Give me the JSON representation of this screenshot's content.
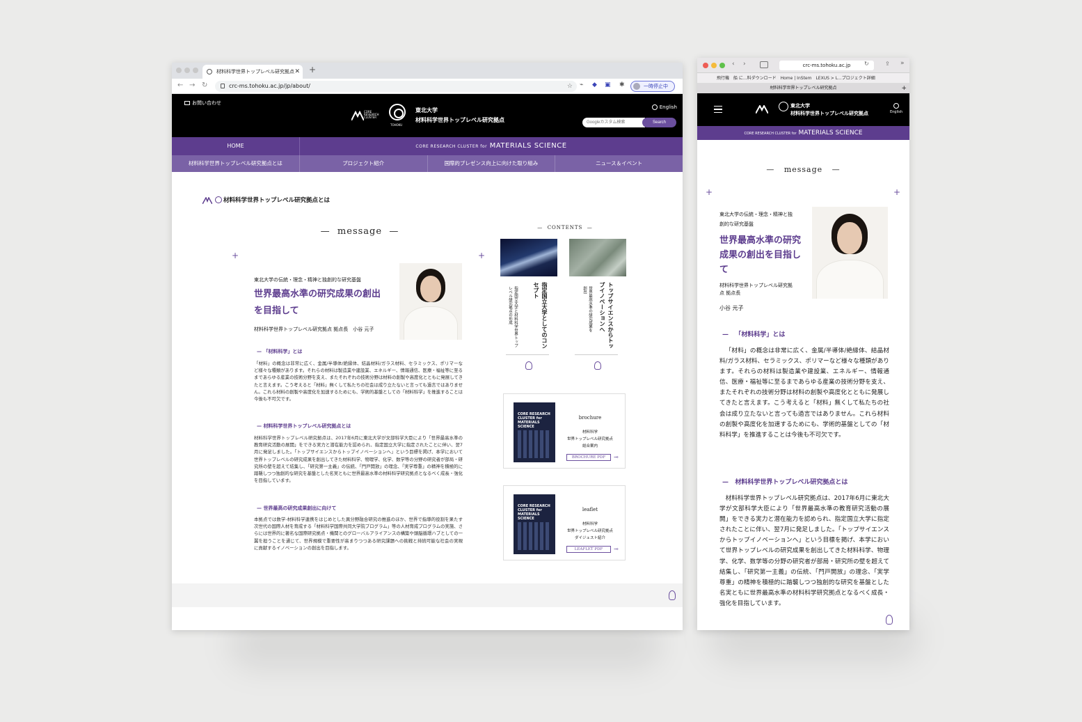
{
  "desktop": {
    "tab_title": "材料科学世界トップレベル研究拠点",
    "url": "crc-ms.tohoku.ac.jp/jp/about/",
    "pause_label": "一時停止中",
    "header": {
      "contact": "お問い合わせ",
      "crc_logo_text": "CORE RESEARCH CLUSTER",
      "tohoku_logo_text": "TOHOKU",
      "univ": "東北大学",
      "center": "材料科学世界トップレベル研究拠点",
      "english": "English",
      "search_placeholder": "Googleカスタム検索",
      "search_button": "Search"
    },
    "nav": {
      "home": "HOME",
      "banner_small": "CORE RESEARCH CLUSTER for",
      "banner_big": "MATERIALS SCIENCE",
      "items": [
        "材料科学世界トップレベル研究拠点とは",
        "プロジェクト紹介",
        "国際的プレゼンス向上に向けた取り組み",
        "ニュース＆イベント"
      ]
    },
    "breadcrumb": "材料科学世界トップレベル研究拠点とは",
    "message_title": "message",
    "lead_sub": "東北大学の伝統・理念・精神と独創的な研究基盤",
    "lead_heading": "世界最高水準の研究成果の創出を目指して",
    "lead_name": "材料科学世界トップレベル研究拠点 拠点長　小谷 元子",
    "sections": [
      {
        "heading": "「材料科学」とは",
        "text": "「材料」の概念は非常に広く、金属/半導体/絶縁体、結晶材料/ガラス材料、セラミックス、ポリマーなど様々な種類があります。それらの材料は製造業や建設業、エネルギー、情報通信、医療・福祉等に至るまであらゆる産業の技術分野を支え、またそれぞれの技術分野は材料の創製や高度化とともに発展してきたと言えます。こう考えると「材料」無くして私たちの社会は成り立たないと言っても過言ではありません。これら材料の創製や高度化を加速するためにも、学術的基盤としての「材料科学」を推進することは今後も不可欠です。"
      },
      {
        "heading": "材料科学世界トップレベル研究拠点とは",
        "text": "材料科学世界トップレベル研究拠点は、2017年6月に東北大学が文部科学大臣により「世界最高水準の教育研究活動の展開」をできる実力と潜在能力を認められ、指定国立大学に指定されたことに伴い、翌7月に発足しました。「トップサイエンスからトップイノベーションへ」という目標を掲げ、本学において世界トップレベルの研究成果を創出してきた材料科学、物理学、化学、数学等の分野の研究者が部局・研究所の壁を超えて結集し、「研究第一主義」の伝統、「門戸開放」の理念、「実学尊重」の精神を積極的に踏襲しつつ独創的な研究を基盤とした名実ともに世界最高水準の材料科学研究拠点となるべく成長・強化を目指しています。"
      },
      {
        "heading": "世界最高の研究成果創出に向けて",
        "text": "本拠点では数学-材料科学連携をはじめとした異分野融合研究の推進のほか、世界で指導的役割を果たす次世代の国際人材を育成する「材料科学国際共同大学院プログラム」等の人材育成プログラムの実施、さらには世界的に著名な国際研究拠点・機関とのグローバルアライアンスの構築や頭脳循環ハブとしての一翼を担うことを通じて、世界規模で重要性が高まりつつある研究課題への挑戦と持続可能な社会の実現に貢献するイノベーションの創出を目指します。"
      }
    ],
    "contents_title": "CONTENTS",
    "cards": [
      {
        "title": "指定国立大学としてのコンセプト",
        "desc": "指定国立大学と材料科学世界トップレベル研究拠点の形成"
      },
      {
        "title": "トップサイエンスからトップイノベーションへ",
        "desc": "世界最高水準の研究成果を創出"
      }
    ],
    "pdfs": [
      {
        "label": "brochure",
        "desc1": "材料科学",
        "desc2": "世界トップレベル研究拠点",
        "desc3": "総合案内",
        "button": "BROCHURE PDF",
        "cover": "CORE RESEARCH CLUSTER for MATERIALS SCIENCE"
      },
      {
        "label": "leaflet",
        "desc1": "材料科学",
        "desc2": "世界トップレベル研究拠点",
        "desc3": "ダイジェスト紹介",
        "button": "LEAFLET PDF",
        "cover": "CORE RESEARCH CLUSTER for MATERIALS SCIENCE"
      }
    ]
  },
  "mobile": {
    "url": "crc-ms.tohoku.ac.jp",
    "bookmarks": "飛行機　船 に...料ダウンロード　Home | InStem　LEXUS > L...プロジェクト詳細",
    "tab_title": "材料科学世界トップレベル研究拠点",
    "univ": "東北大学",
    "center": "材料科学世界トップレベル研究拠点",
    "english": "English",
    "banner_small": "CORE RESEARCH CLUSTER for",
    "banner_big": "MATERIALS SCIENCE",
    "message_title": "message",
    "lead_sub": "東北大学の伝統・理念・精神と独創的な研究基盤",
    "lead_heading": "世界最高水準の研究成果の創出を目指して",
    "role": "材料科学世界トップレベル研究拠点 拠点長",
    "name": "小谷 元子",
    "sec1": "「材料科学」とは",
    "para1": "「材料」の概念は非常に広く、金属/半導体/絶縁体、結晶材料/ガラス材料、セラミックス、ポリマーなど様々な種類があります。それらの材料は製造業や建設業、エネルギー、情報通信、医療・福祉等に至るまであらゆる産業の技術分野を支え、またそれぞれの技術分野は材料の創製や高度化とともに発展してきたと言えます。こう考えると「材料」無くして私たちの社会は成り立たないと言っても過言ではありません。これら材料の創製や高度化を加速するためにも、学術的基盤としての「材料科学」を推進することは今後も不可欠です。",
    "sec2": "材料科学世界トップレベル研究拠点とは",
    "para2": "材料科学世界トップレベル研究拠点は、2017年6月に東北大学が文部科学大臣により「世界最高水準の教育研究活動の展開」をできる実力と潜在能力を認められ、指定国立大学に指定されたことに伴い、翌7月に発足しました。「トップサイエンスからトップイノベーションへ」という目標を掲げ、本学において世界トップレベルの研究成果を創出してきた材料科学、物理学、化学、数学等の分野の研究者が部局・研究所の壁を超えて結集し、「研究第一主義」の伝統、「門戸開放」の理念、「実学尊重」の精神を積極的に踏襲しつつ独創的な研究を基盤とした名実ともに世界最高水準の材料科学研究拠点となるべく成長・強化を目指しています。"
  },
  "colors": {
    "accent": "#5d3d8e",
    "nav_secondary": "#7a62a6",
    "header_bg": "#000000"
  }
}
